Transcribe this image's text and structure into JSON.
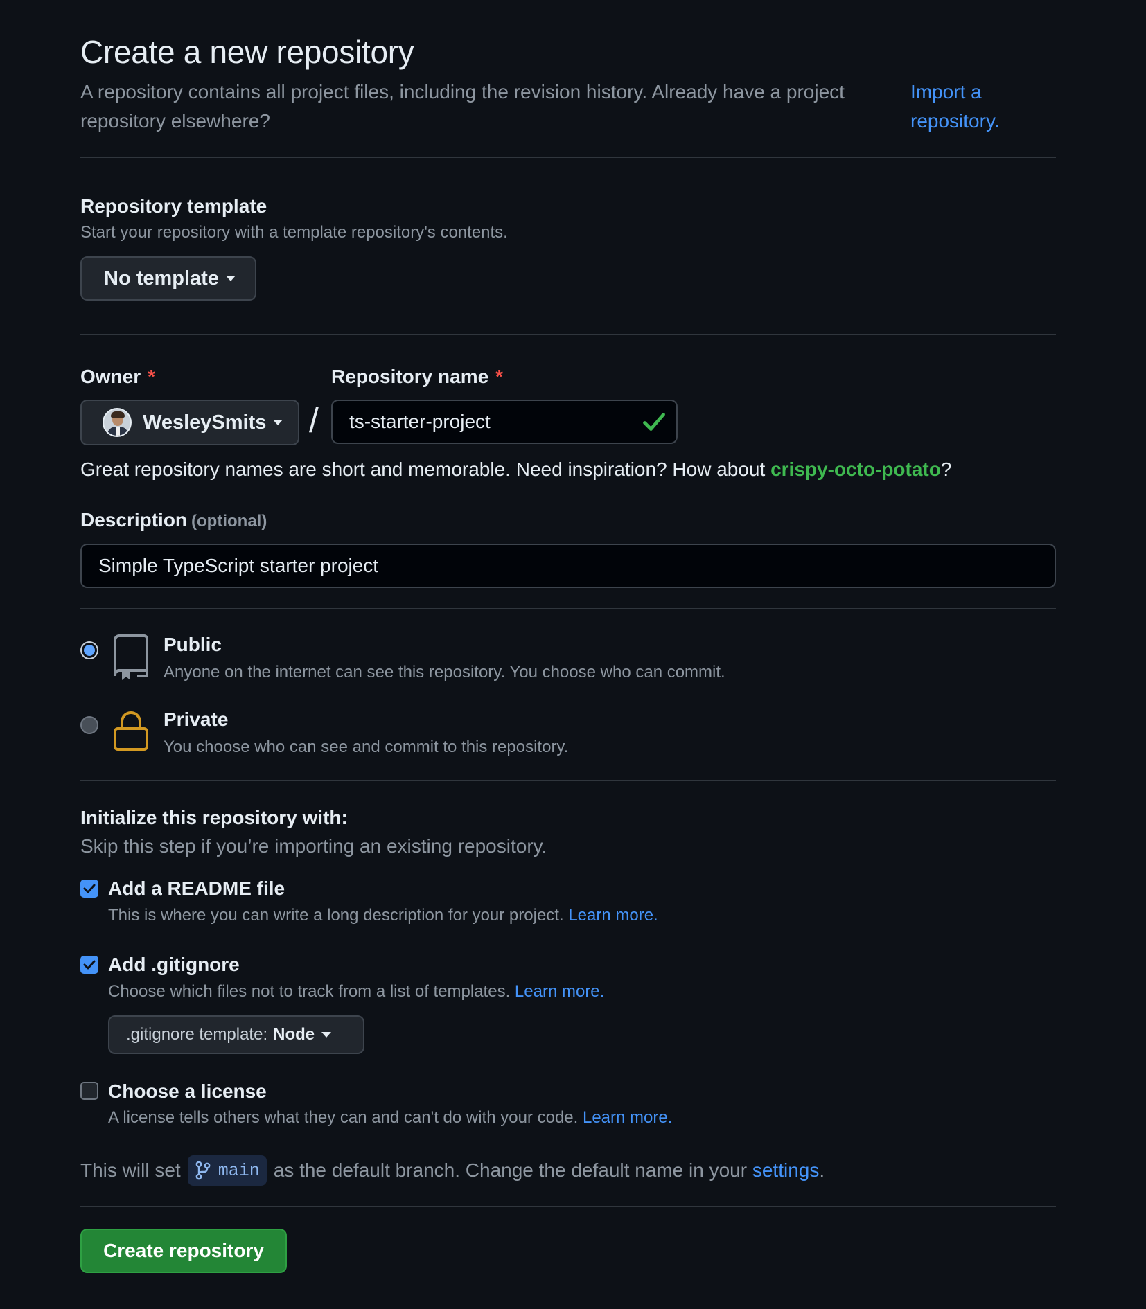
{
  "header": {
    "title": "Create a new repository",
    "intro": "A repository contains all project files, including the revision history. Already have a project repository elsewhere?",
    "import_link": "Import a repository."
  },
  "template": {
    "title": "Repository template",
    "subtitle": "Start your repository with a template repository's contents.",
    "selected": "No template"
  },
  "owner": {
    "label": "Owner",
    "required_mark": "*",
    "selected": "WesleySmits"
  },
  "repo_name": {
    "label": "Repository name",
    "required_mark": "*",
    "value": "ts-starter-project",
    "separator": "/"
  },
  "name_hint": {
    "prefix": "Great repository names are short and memorable. Need inspiration? How about ",
    "suggestion": "crispy-octo-potato",
    "suffix": "?"
  },
  "description": {
    "label": "Description",
    "optional": "(optional)",
    "value": "Simple TypeScript starter project"
  },
  "visibility": [
    {
      "title": "Public",
      "subtitle": "Anyone on the internet can see this repository. You choose who can commit.",
      "selected": true
    },
    {
      "title": "Private",
      "subtitle": "You choose who can see and commit to this repository.",
      "selected": false
    }
  ],
  "initialize": {
    "title": "Initialize this repository with:",
    "subtitle": "Skip this step if you’re importing an existing repository.",
    "options": [
      {
        "title": "Add a README file",
        "subtitle": "This is where you can write a long description for your project.",
        "link": "Learn more.",
        "checked": true
      },
      {
        "title": "Add .gitignore",
        "subtitle": "Choose which files not to track from a list of templates.",
        "link": "Learn more.",
        "checked": true
      },
      {
        "title": "Choose a license",
        "subtitle": "A license tells others what they can and can't do with your code.",
        "link": "Learn more.",
        "checked": false
      }
    ],
    "gitignore_template_label": ".gitignore template:",
    "gitignore_template_value": "Node"
  },
  "default_branch": {
    "prefix": "This will set",
    "branch": "main",
    "middle": "as the default branch. Change the default name in your",
    "link": "settings",
    "suffix": "."
  },
  "submit": {
    "label": "Create repository"
  },
  "colors": {
    "background": "#0d1117",
    "link": "#4493f8",
    "success": "#3fb950",
    "primary_button": "#238636",
    "required": "#f85149",
    "lock_icon": "#d29922"
  }
}
